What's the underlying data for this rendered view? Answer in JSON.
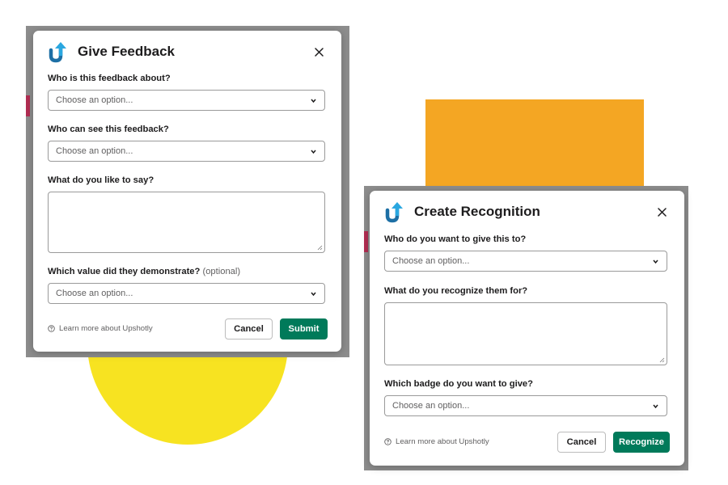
{
  "colors": {
    "primary_button": "#007a5a",
    "icon_blue": "#2aa7e0",
    "icon_dark": "#1d6fa5",
    "deco_yellow": "#f7e321",
    "deco_orange": "#f4a623",
    "backdrop_gray": "#8d8d8d"
  },
  "feedback_modal": {
    "icon": "upshotly-arrow-icon",
    "title": "Give Feedback",
    "about_label": "Who is this feedback about?",
    "about_placeholder": "Choose an option...",
    "visibility_label": "Who can see this feedback?",
    "visibility_placeholder": "Choose an option...",
    "message_label": "What do you like to say?",
    "value_label": "Which value did they demonstrate?",
    "value_optional": "(optional)",
    "value_placeholder": "Choose an option...",
    "learn_more": "Learn more about Upshotly",
    "cancel_label": "Cancel",
    "submit_label": "Submit"
  },
  "recognition_modal": {
    "icon": "upshotly-arrow-icon",
    "title": "Create Recognition",
    "recipient_label": "Who do you want to give this to?",
    "recipient_placeholder": "Choose an option...",
    "reason_label": "What do you recognize them for?",
    "badge_label": "Which badge do you want to give?",
    "badge_placeholder": "Choose an option...",
    "learn_more": "Learn more about Upshotly",
    "cancel_label": "Cancel",
    "recognize_label": "Recognize"
  }
}
